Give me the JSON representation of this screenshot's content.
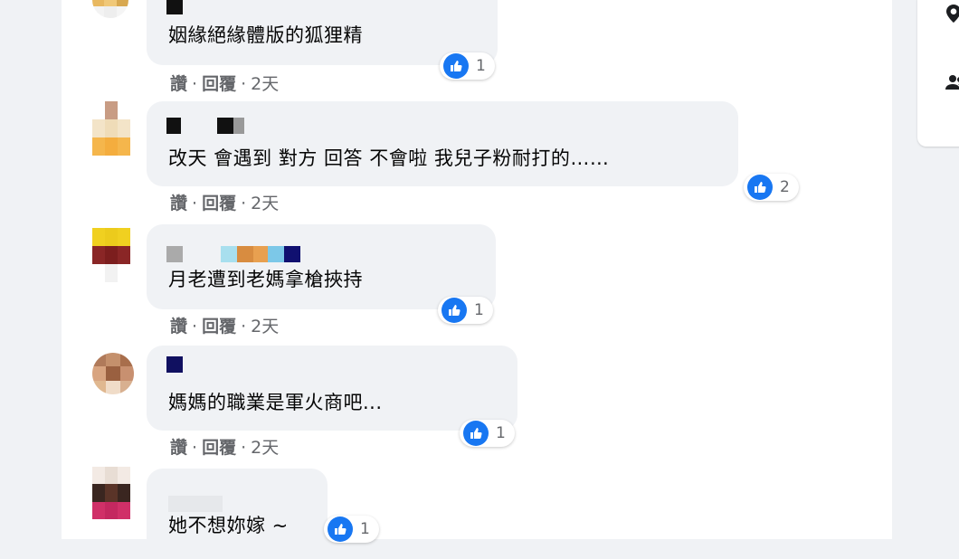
{
  "actions": {
    "like_label": "讚",
    "reply_label": "回覆",
    "separator": "·"
  },
  "comments": [
    {
      "text": "姻緣絕緣體版的狐狸精",
      "likes": "1",
      "time": "2天"
    },
    {
      "text": "改天 會遇到 對方 回答 不會啦 我兒子粉耐打的……",
      "likes": "2",
      "time": "2天"
    },
    {
      "text": "月老遭到老媽拿槍挾持",
      "likes": "1",
      "time": "2天"
    },
    {
      "text": "媽媽的職業是軍火商吧...",
      "likes": "1",
      "time": "2天"
    },
    {
      "text": "她不想妳嫁 ~",
      "likes": "1",
      "time": ""
    }
  ],
  "colors": {
    "like_blue": "#1877f2",
    "bubble_gray": "#f0f2f5",
    "meta_gray": "#65676b"
  },
  "icons": {
    "like": "thumbs-up-icon",
    "side_1": "location-pin-icon",
    "side_2": "people-icon"
  }
}
